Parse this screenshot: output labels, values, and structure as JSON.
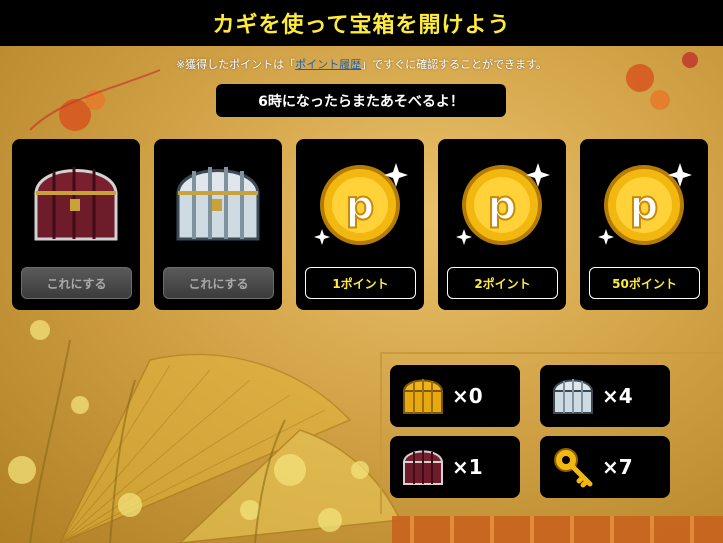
{
  "header": {
    "title": "カギを使って宝箱を開けよう"
  },
  "notice": {
    "prefix": "※獲得したポイントは「",
    "link": "ポイント履歴",
    "suffix": "」ですぐに確認することができます。"
  },
  "timer": {
    "text": "6時になったらまたあそべるよ！"
  },
  "cards": [
    {
      "type": "chest",
      "chest_color": "red",
      "button": "これにする",
      "enabled": false
    },
    {
      "type": "chest",
      "chest_color": "silver",
      "button": "これにする",
      "enabled": false
    },
    {
      "type": "coin",
      "button": "1ポイント"
    },
    {
      "type": "coin",
      "button": "2ポイント"
    },
    {
      "type": "coin",
      "button": "50ポイント"
    }
  ],
  "inventory": {
    "gold_chest": "×0",
    "silver_chest": "×4",
    "red_chest": "×1",
    "key": "×7"
  },
  "colors": {
    "title_yellow": "#ffeb3b",
    "panel_black": "#000000",
    "background_gold": "#d2a247",
    "link_blue": "#1e5fb4"
  },
  "icons": [
    "red-chest-icon",
    "silver-chest-icon",
    "gold-chest-icon",
    "point-coin-icon",
    "gold-key-icon",
    "sparkle-icon"
  ]
}
